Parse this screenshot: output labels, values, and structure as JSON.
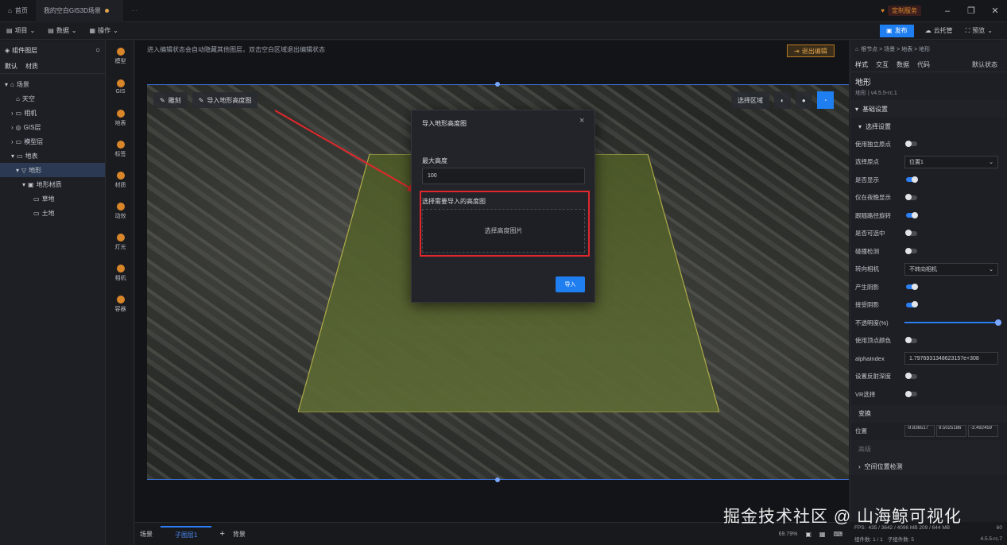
{
  "tabs": [
    {
      "label": "首页",
      "icon": "home-icon"
    },
    {
      "label": "我的空白GIS3D场景",
      "dirty": true
    }
  ],
  "window": {
    "badge": "定制服务"
  },
  "menu": [
    "项目",
    "数据",
    "操作"
  ],
  "top_actions": {
    "publish": "发布",
    "cloud": "云托管",
    "preview": "预览"
  },
  "left_panel": {
    "title": "组件图层",
    "tabs": [
      "默认",
      "材质"
    ],
    "tree": [
      {
        "label": "场景",
        "level": 0
      },
      {
        "label": "天空",
        "level": 1
      },
      {
        "label": "相机",
        "level": 1
      },
      {
        "label": "GIS层",
        "level": 1
      },
      {
        "label": "模型层",
        "level": 1
      },
      {
        "label": "地表",
        "level": 1
      },
      {
        "label": "地形",
        "level": 2,
        "selected": true
      },
      {
        "label": "地形材质",
        "level": 3
      },
      {
        "label": "草地",
        "level": 4
      },
      {
        "label": "土地",
        "level": 4
      }
    ]
  },
  "icon_rail": [
    "模型",
    "GIS",
    "地表",
    "标签",
    "材质",
    "动效",
    "灯光",
    "相机",
    "容器"
  ],
  "viewport": {
    "banner": "进入编辑状态会自动隐藏其他图层，双击空白区域退出编辑状态",
    "exit_edit": "退出编辑",
    "tool_carve": "雕刻",
    "tool_import": "导入地形高度图",
    "select_region": "选择区域"
  },
  "modal": {
    "title": "导入地形高度图",
    "max_height_label": "最大高度",
    "max_height_value": "100",
    "pick_label": "选择需要导入的高度图",
    "pick_zone": "选择高度图片",
    "import_button": "导入"
  },
  "right_panel": {
    "breadcrumb": "根节点 > 场景 > 地表 > 地形",
    "tabs": [
      "样式",
      "交互",
      "数据",
      "代码"
    ],
    "state": "默认状态",
    "node_title": "地形",
    "node_sub": "地形 | v4.5.5-rc.1",
    "section_basic": "基础设置",
    "section_select": "选择设置",
    "rows": [
      {
        "label": "使用独立原点",
        "type": "toggle",
        "on": false
      },
      {
        "label": "选择原点",
        "type": "select",
        "value": "位置1"
      },
      {
        "label": "是否显示",
        "type": "toggle",
        "on": true
      },
      {
        "label": "仅在夜晚显示",
        "type": "toggle",
        "on": false
      },
      {
        "label": "跟随路径旋转",
        "type": "toggle",
        "on": true
      },
      {
        "label": "是否可选中",
        "type": "toggle",
        "on": false
      },
      {
        "label": "碰撞检测",
        "type": "toggle",
        "on": false
      },
      {
        "label": "转向相机",
        "type": "select",
        "value": "不转向相机"
      },
      {
        "label": "产生阴影",
        "type": "toggle",
        "on": true
      },
      {
        "label": "接受阴影",
        "type": "toggle",
        "on": true
      },
      {
        "label": "不透明度(%)",
        "type": "slider",
        "value": 100
      },
      {
        "label": "使用顶点颜色",
        "type": "toggle",
        "on": false
      },
      {
        "label": "alphaIndex",
        "type": "text",
        "value": "1.7976931348623157e+308"
      },
      {
        "label": "设置反射深度",
        "type": "toggle",
        "on": false
      },
      {
        "label": "VR选择",
        "type": "toggle",
        "on": false
      }
    ],
    "section_transform": "变换",
    "position_label": "位置",
    "position": [
      "-9.836517",
      "9.5025186",
      "-3.492459"
    ],
    "section_extra": "高级",
    "section_space": "空间位置检测"
  },
  "bottom": {
    "scene_tab": "场景",
    "layer_tab": "子图层1",
    "add": "+",
    "bg_tab": "背景",
    "zoom": "69.79%"
  },
  "status": {
    "fps_label": "FPS:",
    "fps_value": "60",
    "stats": "435 / 3642 / 4096 MB  209 / 644 MB",
    "components": "组件数: 1 / 1",
    "children": "子组件数: 5",
    "version": "4.5.5-rc.7"
  },
  "watermark": "掘金技术社区 @ 山海鲸可视化",
  "colors": {
    "accent": "#1f7ef0",
    "highlight": "#e0282c",
    "terrain": "#5a6b2e"
  }
}
